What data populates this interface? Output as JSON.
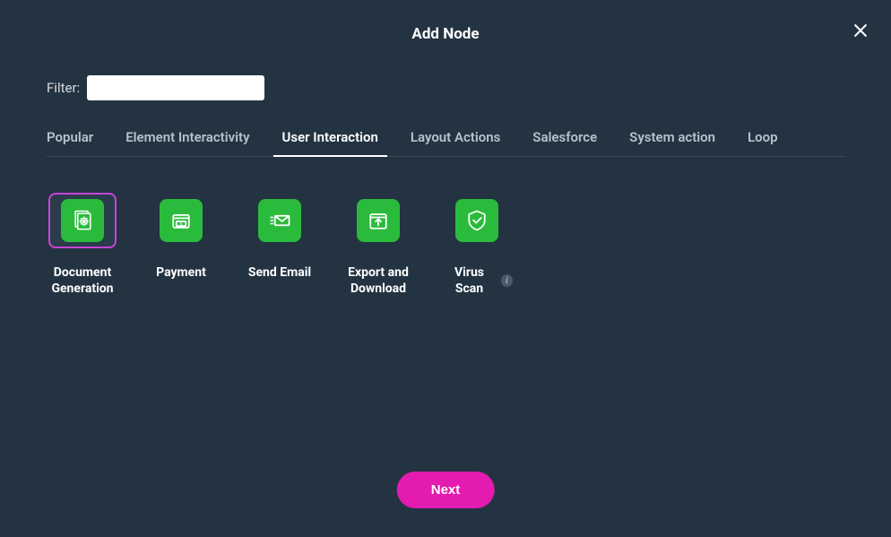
{
  "modal": {
    "title": "Add Node",
    "close_aria": "Close"
  },
  "filter": {
    "label": "Filter:",
    "value": ""
  },
  "tabs": [
    {
      "label": "Popular",
      "active": false
    },
    {
      "label": "Element Interactivity",
      "active": false
    },
    {
      "label": "User Interaction",
      "active": true
    },
    {
      "label": "Layout Actions",
      "active": false
    },
    {
      "label": "Salesforce",
      "active": false
    },
    {
      "label": "System action",
      "active": false
    },
    {
      "label": "Loop",
      "active": false
    }
  ],
  "nodes": [
    {
      "label": "Document Generation",
      "icon": "document-gear-icon",
      "selected": true,
      "info": false
    },
    {
      "label": "Payment",
      "icon": "wallet-icon",
      "selected": false,
      "info": false
    },
    {
      "label": "Send Email",
      "icon": "send-email-icon",
      "selected": false,
      "info": false
    },
    {
      "label": "Export and Download",
      "icon": "export-icon",
      "selected": false,
      "info": false
    },
    {
      "label": "Virus Scan",
      "icon": "shield-check-icon",
      "selected": false,
      "info": true
    }
  ],
  "footer": {
    "next_label": "Next"
  },
  "colors": {
    "bg": "#233342",
    "accent_green": "#2bbb3c",
    "accent_pink": "#e31bb0",
    "selected_border": "#c744d6"
  }
}
